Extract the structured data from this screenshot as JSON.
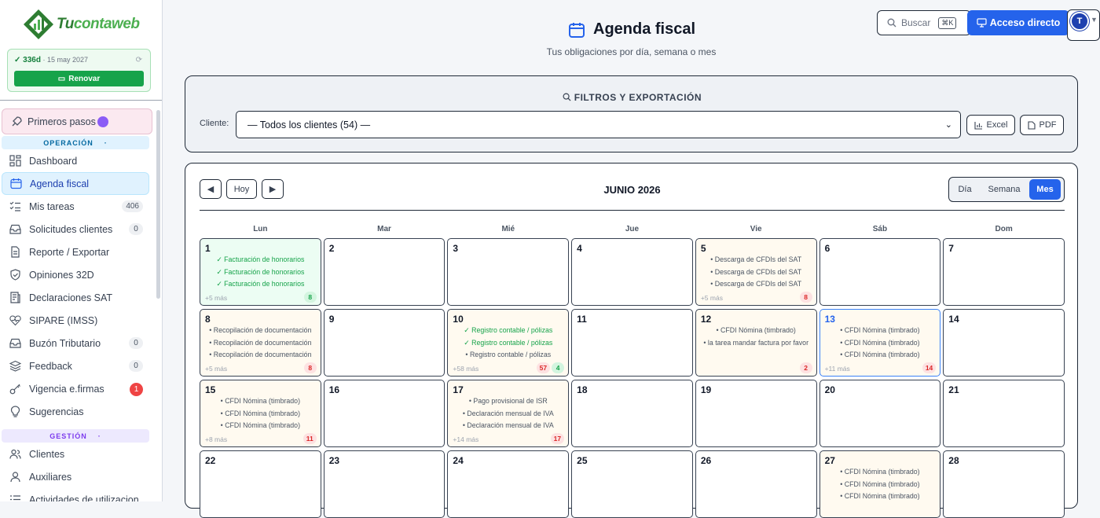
{
  "brand": {
    "name_part1": "Tu",
    "name_part2": "contaweb"
  },
  "subscription": {
    "days": "✓ 336d",
    "date": "· 15 may 2027",
    "renew_label": "Renovar"
  },
  "sidebar": {
    "first_steps": "Primeros pasos",
    "section_operacion": "OPERACIÓN",
    "section_gestion": "GESTIÓN",
    "items": [
      {
        "label": "Dashboard",
        "icon": "dashboard-icon"
      },
      {
        "label": "Agenda fiscal",
        "icon": "calendar-icon"
      },
      {
        "label": "Mis tareas",
        "icon": "tasks-icon",
        "badge": "406"
      },
      {
        "label": "Solicitudes clientes",
        "icon": "inbox-icon",
        "badge": "0"
      },
      {
        "label": "Reporte / Exportar",
        "icon": "document-icon"
      },
      {
        "label": "Opiniones 32D",
        "icon": "shield-icon"
      },
      {
        "label": "Declaraciones SAT",
        "icon": "receipt-icon"
      },
      {
        "label": "SIPARE (IMSS)",
        "icon": "heart-icon"
      },
      {
        "label": "Buzón Tributario",
        "icon": "mailbox-icon",
        "badge": "0"
      },
      {
        "label": "Feedback",
        "icon": "layers-icon",
        "badge": "0"
      },
      {
        "label": "Vigencia e.firmas",
        "icon": "key-icon",
        "badge": "1"
      },
      {
        "label": "Sugerencias",
        "icon": "lightbulb-icon"
      }
    ],
    "gestion_items": [
      {
        "label": "Clientes",
        "icon": "users-icon"
      },
      {
        "label": "Auxiliares",
        "icon": "user-icon"
      },
      {
        "label": "Actividades de utilizacion",
        "icon": "list-icon"
      }
    ]
  },
  "header": {
    "title": "Agenda fiscal",
    "subtitle": "Tus obligaciones por día, semana o mes",
    "search_placeholder": "Buscar",
    "search_kbd": "⌘K",
    "access_label": "Acceso directo",
    "avatar_initial": "T"
  },
  "filters": {
    "title": "FILTROS Y EXPORTACIÓN",
    "client_label": "Cliente:",
    "client_value": "— Todos los clientes (54) —",
    "excel_label": "Excel",
    "pdf_label": "PDF"
  },
  "calendar": {
    "prev_label": "◀",
    "today_label": "Hoy",
    "next_label": "▶",
    "month_title": "JUNIO 2026",
    "views": [
      "Día",
      "Semana",
      "Mes"
    ],
    "weekdays": [
      "Lun",
      "Mar",
      "Mié",
      "Jue",
      "Vie",
      "Sáb",
      "Dom"
    ],
    "days": [
      {
        "num": "1",
        "style": "green",
        "events": [
          {
            "t": "✓ Facturación de honorarios",
            "ok": true
          },
          {
            "t": "✓ Facturación de honorarios",
            "ok": true
          },
          {
            "t": "✓ Facturación de honorarios",
            "ok": true
          }
        ],
        "more": "+5 más",
        "counts": [
          {
            "v": "8",
            "c": "green"
          }
        ]
      },
      {
        "num": "2"
      },
      {
        "num": "3"
      },
      {
        "num": "4"
      },
      {
        "num": "5",
        "style": "amber",
        "events": [
          {
            "t": "• Descarga de CFDIs del SAT"
          },
          {
            "t": "• Descarga de CFDIs del SAT"
          },
          {
            "t": "• Descarga de CFDIs del SAT"
          }
        ],
        "more": "+5 más",
        "counts": [
          {
            "v": "8",
            "c": "red"
          }
        ]
      },
      {
        "num": "6"
      },
      {
        "num": "7"
      },
      {
        "num": "8",
        "style": "amber",
        "events": [
          {
            "t": "• Recopilación de documentación"
          },
          {
            "t": "• Recopilación de documentación"
          },
          {
            "t": "• Recopilación de documentación"
          }
        ],
        "more": "+5 más",
        "counts": [
          {
            "v": "8",
            "c": "red"
          }
        ]
      },
      {
        "num": "9"
      },
      {
        "num": "10",
        "style": "amber",
        "events": [
          {
            "t": "✓ Registro contable / pólizas",
            "ok": true
          },
          {
            "t": "✓ Registro contable / pólizas",
            "ok": true
          },
          {
            "t": "• Registro contable / pólizas"
          }
        ],
        "more": "+58 más",
        "counts": [
          {
            "v": "57",
            "c": "red"
          },
          {
            "v": "4",
            "c": "green"
          }
        ]
      },
      {
        "num": "11"
      },
      {
        "num": "12",
        "style": "amber",
        "events": [
          {
            "t": "• CFDI Nómina (timbrado)"
          },
          {
            "t": "• la tarea mandar factura por favor"
          }
        ],
        "more": "",
        "counts": [
          {
            "v": "2",
            "c": "red"
          }
        ]
      },
      {
        "num": "13",
        "style": "amber",
        "today": true,
        "events": [
          {
            "t": "• CFDI Nómina (timbrado)"
          },
          {
            "t": "• CFDI Nómina (timbrado)"
          },
          {
            "t": "• CFDI Nómina (timbrado)"
          }
        ],
        "more": "+11 más",
        "counts": [
          {
            "v": "14",
            "c": "red"
          }
        ]
      },
      {
        "num": "14"
      },
      {
        "num": "15",
        "style": "amber",
        "events": [
          {
            "t": "• CFDI Nómina (timbrado)"
          },
          {
            "t": "• CFDI Nómina (timbrado)"
          },
          {
            "t": "• CFDI Nómina (timbrado)"
          }
        ],
        "more": "+8 más",
        "counts": [
          {
            "v": "11",
            "c": "red"
          }
        ]
      },
      {
        "num": "16"
      },
      {
        "num": "17",
        "style": "amber",
        "events": [
          {
            "t": "• Pago provisional de ISR"
          },
          {
            "t": "• Declaración mensual de IVA"
          },
          {
            "t": "• Declaración mensual de IVA"
          }
        ],
        "more": "+14 más",
        "counts": [
          {
            "v": "17",
            "c": "red"
          }
        ]
      },
      {
        "num": "18"
      },
      {
        "num": "19"
      },
      {
        "num": "20"
      },
      {
        "num": "21"
      },
      {
        "num": "22"
      },
      {
        "num": "23"
      },
      {
        "num": "24"
      },
      {
        "num": "25"
      },
      {
        "num": "26"
      },
      {
        "num": "27",
        "style": "amber",
        "events": [
          {
            "t": "• CFDI Nómina (timbrado)"
          },
          {
            "t": "• CFDI Nómina (timbrado)"
          },
          {
            "t": "• CFDI Nómina (timbrado)"
          }
        ],
        "more": "",
        "counts": []
      },
      {
        "num": "28"
      }
    ]
  },
  "colors": {
    "accent": "#2563eb",
    "success": "#16a34a",
    "danger": "#ef4444"
  }
}
